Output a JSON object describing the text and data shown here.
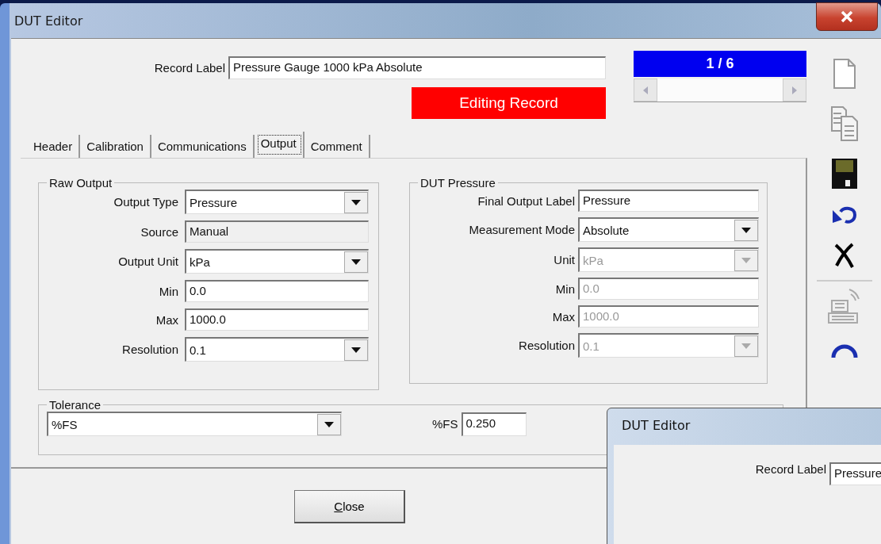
{
  "window": {
    "title": "DUT Editor"
  },
  "record_label": {
    "label": "Record Label",
    "value": "Pressure Gauge 1000 kPa Absolute"
  },
  "status": "Editing Record",
  "record_counter": "1 / 6",
  "tabs": [
    {
      "label": "Header",
      "selected": false
    },
    {
      "label": "Calibration",
      "selected": false
    },
    {
      "label": "Communications",
      "selected": false
    },
    {
      "label": "Output",
      "selected": true
    },
    {
      "label": "Comment",
      "selected": false
    }
  ],
  "raw_output": {
    "title": "Raw Output",
    "fields": [
      {
        "label": "Output Type",
        "value": "Pressure",
        "kind": "dropdown"
      },
      {
        "label": "Source",
        "value": "Manual",
        "kind": "readonly"
      },
      {
        "label": "Output Unit",
        "value": "kPa",
        "kind": "dropdown"
      },
      {
        "label": "Min",
        "value": "0.0",
        "kind": "text"
      },
      {
        "label": "Max",
        "value": "1000.0",
        "kind": "text"
      },
      {
        "label": "Resolution",
        "value": "0.1",
        "kind": "dropdown"
      }
    ]
  },
  "dut_pressure": {
    "title": "DUT Pressure",
    "fields": [
      {
        "label": "Final Output Label",
        "value": "Pressure",
        "kind": "text",
        "disabled": false
      },
      {
        "label": "Measurement Mode",
        "value": "Absolute",
        "kind": "dropdown",
        "disabled": false
      },
      {
        "label": "Unit",
        "value": "kPa",
        "kind": "dropdown",
        "disabled": true
      },
      {
        "label": "Min",
        "value": "0.0",
        "kind": "text",
        "disabled": true
      },
      {
        "label": "Max",
        "value": "1000.0",
        "kind": "text",
        "disabled": true
      },
      {
        "label": "Resolution",
        "value": "0.1",
        "kind": "dropdown",
        "disabled": true
      }
    ]
  },
  "tolerance": {
    "title": "Tolerance",
    "type": "%FS",
    "value_label": "%FS",
    "value": "0.250"
  },
  "close_button": "Close",
  "background_window": {
    "title": "DUT Editor",
    "record_label": "Record Label",
    "value": "Pressure"
  }
}
